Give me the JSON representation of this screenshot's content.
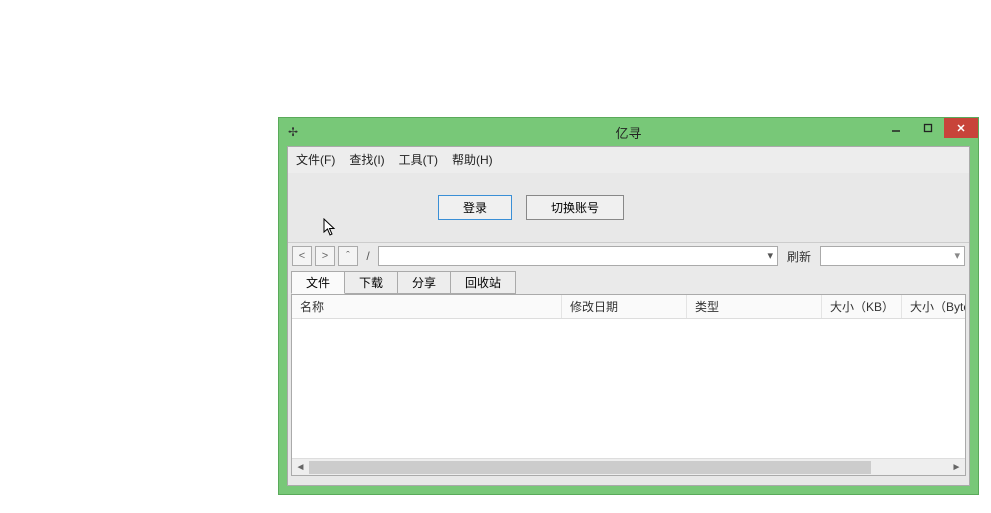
{
  "titlebar": {
    "title": "亿寻"
  },
  "menu": {
    "file": "文件(F)",
    "find": "查找(I)",
    "tools": "工具(T)",
    "help": "帮助(H)"
  },
  "login": {
    "login_btn": "登录",
    "switch_btn": "切换账号"
  },
  "nav": {
    "back": "<",
    "forward": ">",
    "up": "ˆ",
    "separator": "/",
    "refresh": "刷新"
  },
  "tabs": {
    "file": "文件",
    "download": "下载",
    "share": "分享",
    "recycle": "回收站"
  },
  "columns": {
    "name": "名称",
    "modified": "修改日期",
    "type": "类型",
    "size_kb": "大小（KB）",
    "size_byte": "大小（Byte）"
  }
}
